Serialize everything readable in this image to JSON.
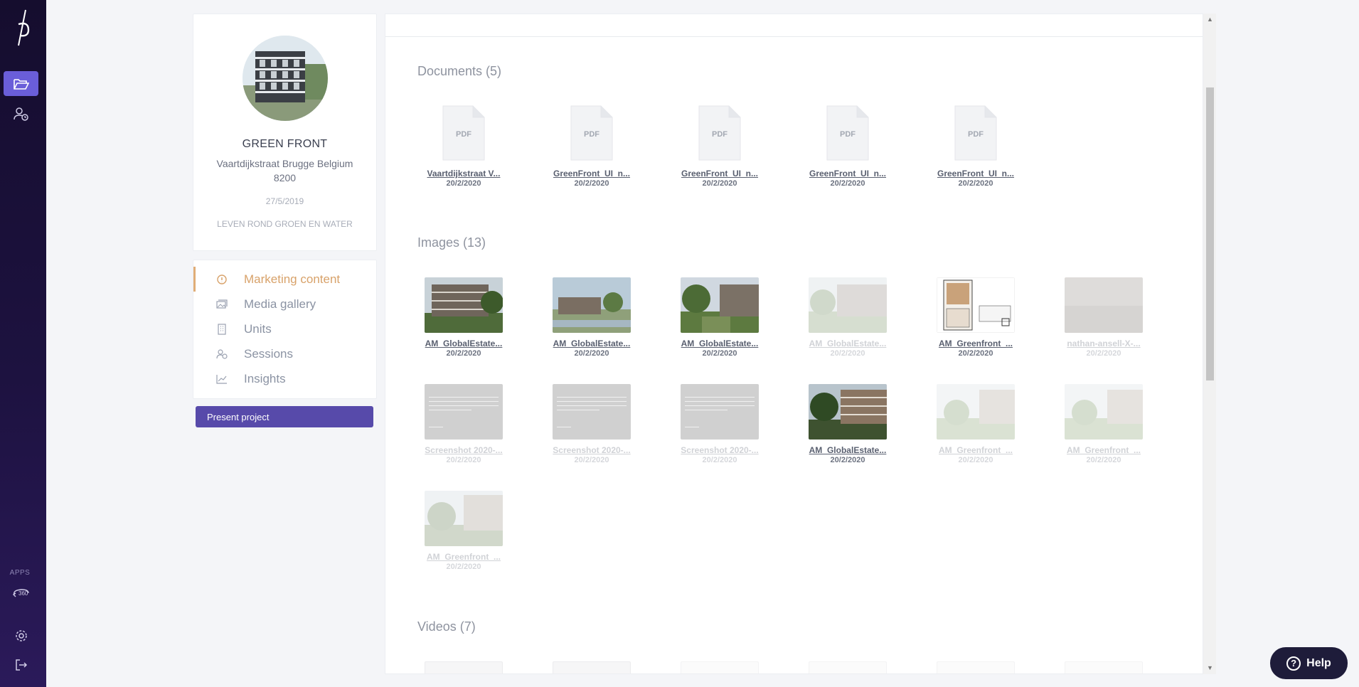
{
  "rail": {
    "apps_label": "APPS",
    "app_360_label": "360"
  },
  "project": {
    "name": "GREEN FRONT",
    "address": "Vaartdijkstraat Brugge Belgium 8200",
    "date": "27/5/2019",
    "tagline": "LEVEN ROND GROEN EN WATER"
  },
  "menu": {
    "items": [
      {
        "label": "Marketing content",
        "icon": "info-circle-icon"
      },
      {
        "label": "Media gallery",
        "icon": "gallery-icon"
      },
      {
        "label": "Units",
        "icon": "building-icon"
      },
      {
        "label": "Sessions",
        "icon": "user-clock-icon"
      },
      {
        "label": "Insights",
        "icon": "chart-line-icon"
      }
    ],
    "present_button": "Present project"
  },
  "documents": {
    "title": "Documents (5)",
    "file_badge": "PDF",
    "items": [
      {
        "name": "Vaartdijkstraat V...",
        "date": "20/2/2020"
      },
      {
        "name": "GreenFront_UI_n...",
        "date": "20/2/2020"
      },
      {
        "name": "GreenFront_UI_n...",
        "date": "20/2/2020"
      },
      {
        "name": "GreenFront_UI_n...",
        "date": "20/2/2020"
      },
      {
        "name": "GreenFront_UI_n...",
        "date": "20/2/2020"
      }
    ]
  },
  "images": {
    "title": "Images (13)",
    "items": [
      {
        "name": "AM_GlobalEstate...",
        "date": "20/2/2020"
      },
      {
        "name": "AM_GlobalEstate...",
        "date": "20/2/2020"
      },
      {
        "name": "AM_GlobalEstate...",
        "date": "20/2/2020"
      },
      {
        "name": "AM_GlobalEstate...",
        "date": "20/2/2020"
      },
      {
        "name": "AM_Greenfront_...",
        "date": "20/2/2020"
      },
      {
        "name": "nathan-ansell-X-...",
        "date": "20/2/2020"
      },
      {
        "name": "Screenshot 2020-...",
        "date": "20/2/2020"
      },
      {
        "name": "Screenshot 2020-...",
        "date": "20/2/2020"
      },
      {
        "name": "Screenshot 2020-...",
        "date": "20/2/2020"
      },
      {
        "name": "AM_GlobalEstate...",
        "date": "20/2/2020"
      },
      {
        "name": "AM_Greenfront_...",
        "date": "20/2/2020"
      },
      {
        "name": "AM_Greenfront_...",
        "date": "20/2/2020"
      },
      {
        "name": "AM_Greenfront_...",
        "date": "20/2/2020"
      }
    ]
  },
  "videos": {
    "title": "Videos (7)"
  },
  "help": {
    "label": "Help"
  },
  "colors": {
    "accent": "#574aaa",
    "rail_active": "#6a5ed9",
    "menu_active": "#d8a26a"
  }
}
